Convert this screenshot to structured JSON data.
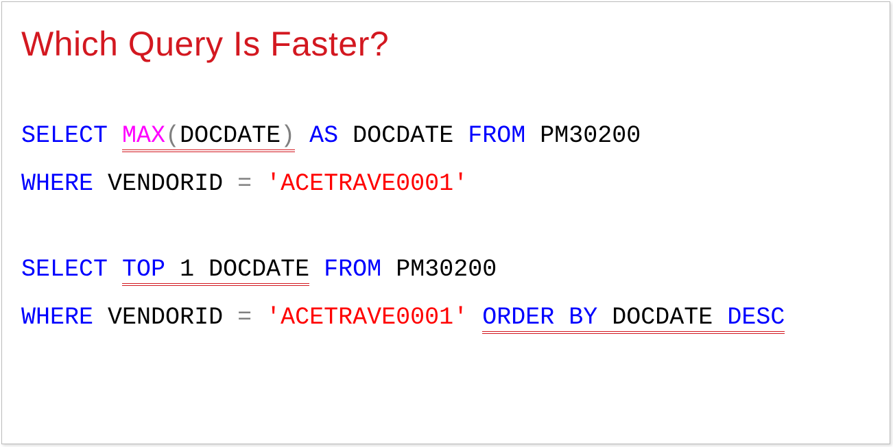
{
  "title": "Which Query Is Faster?",
  "q1": {
    "select": "SELECT",
    "max": "MAX",
    "lparen": "(",
    "col": "DOCDATE",
    "rparen": ")",
    "as": "AS",
    "alias": "DOCDATE",
    "from": "FROM",
    "table": "PM30200",
    "where": "WHERE",
    "wcol": "VENDORID",
    "eq": "=",
    "val": "'ACETRAVE0001'"
  },
  "q2": {
    "select": "SELECT",
    "top": "TOP",
    "n": "1",
    "col": "DOCDATE",
    "from": "FROM",
    "table": "PM30200",
    "where": "WHERE",
    "wcol": "VENDORID",
    "eq": "=",
    "val": "'ACETRAVE0001'",
    "order": "ORDER",
    "by": "BY",
    "ocol": "DOCDATE",
    "desc": "DESC"
  }
}
